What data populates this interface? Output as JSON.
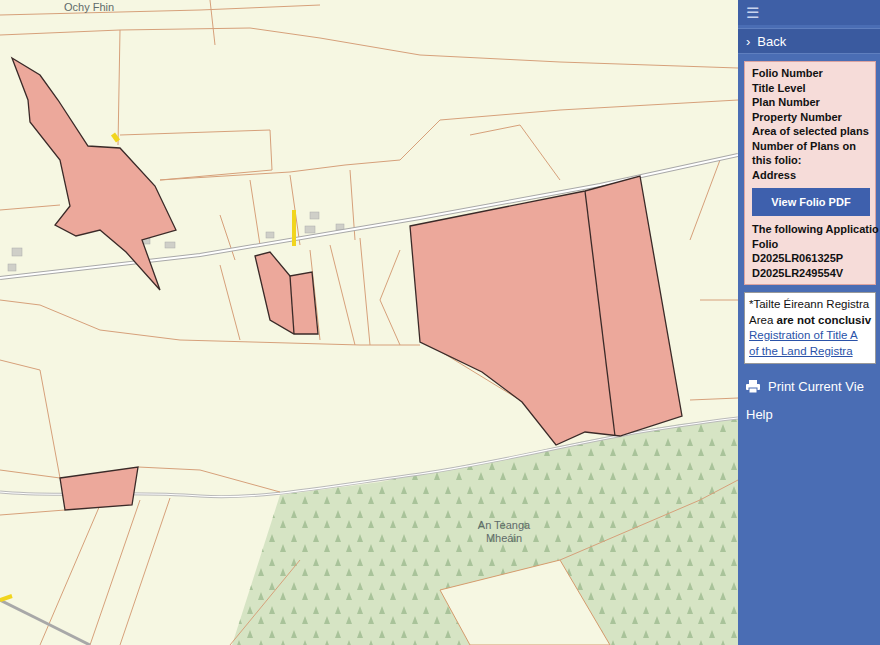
{
  "map": {
    "labels": [
      {
        "text": "Ochy Fhin"
      },
      {
        "text": "An Teanga Mheáin"
      }
    ]
  },
  "panel": {
    "menu_icon": "☰",
    "back": {
      "icon": "›",
      "label": "Back"
    },
    "fields": [
      "Folio Number",
      "Title Level",
      "Plan Number",
      "Property Number",
      "Area of selected plans",
      "Number of Plans on",
      "this folio:",
      "Address"
    ],
    "button": "View Folio PDF",
    "applications": {
      "heading": [
        "The following Applicatio",
        "Folio"
      ],
      "items": [
        "D2025LR061325P",
        "D2025LR249554V"
      ]
    },
    "note": {
      "line1": "*Tailte Éireann Registra",
      "line2_plain": "Area ",
      "line2_bold": "are not conclusiv",
      "links": [
        "Registration of Title A",
        "of the Land Registra"
      ]
    },
    "print": "Print Current Vie",
    "help": "Help"
  }
}
